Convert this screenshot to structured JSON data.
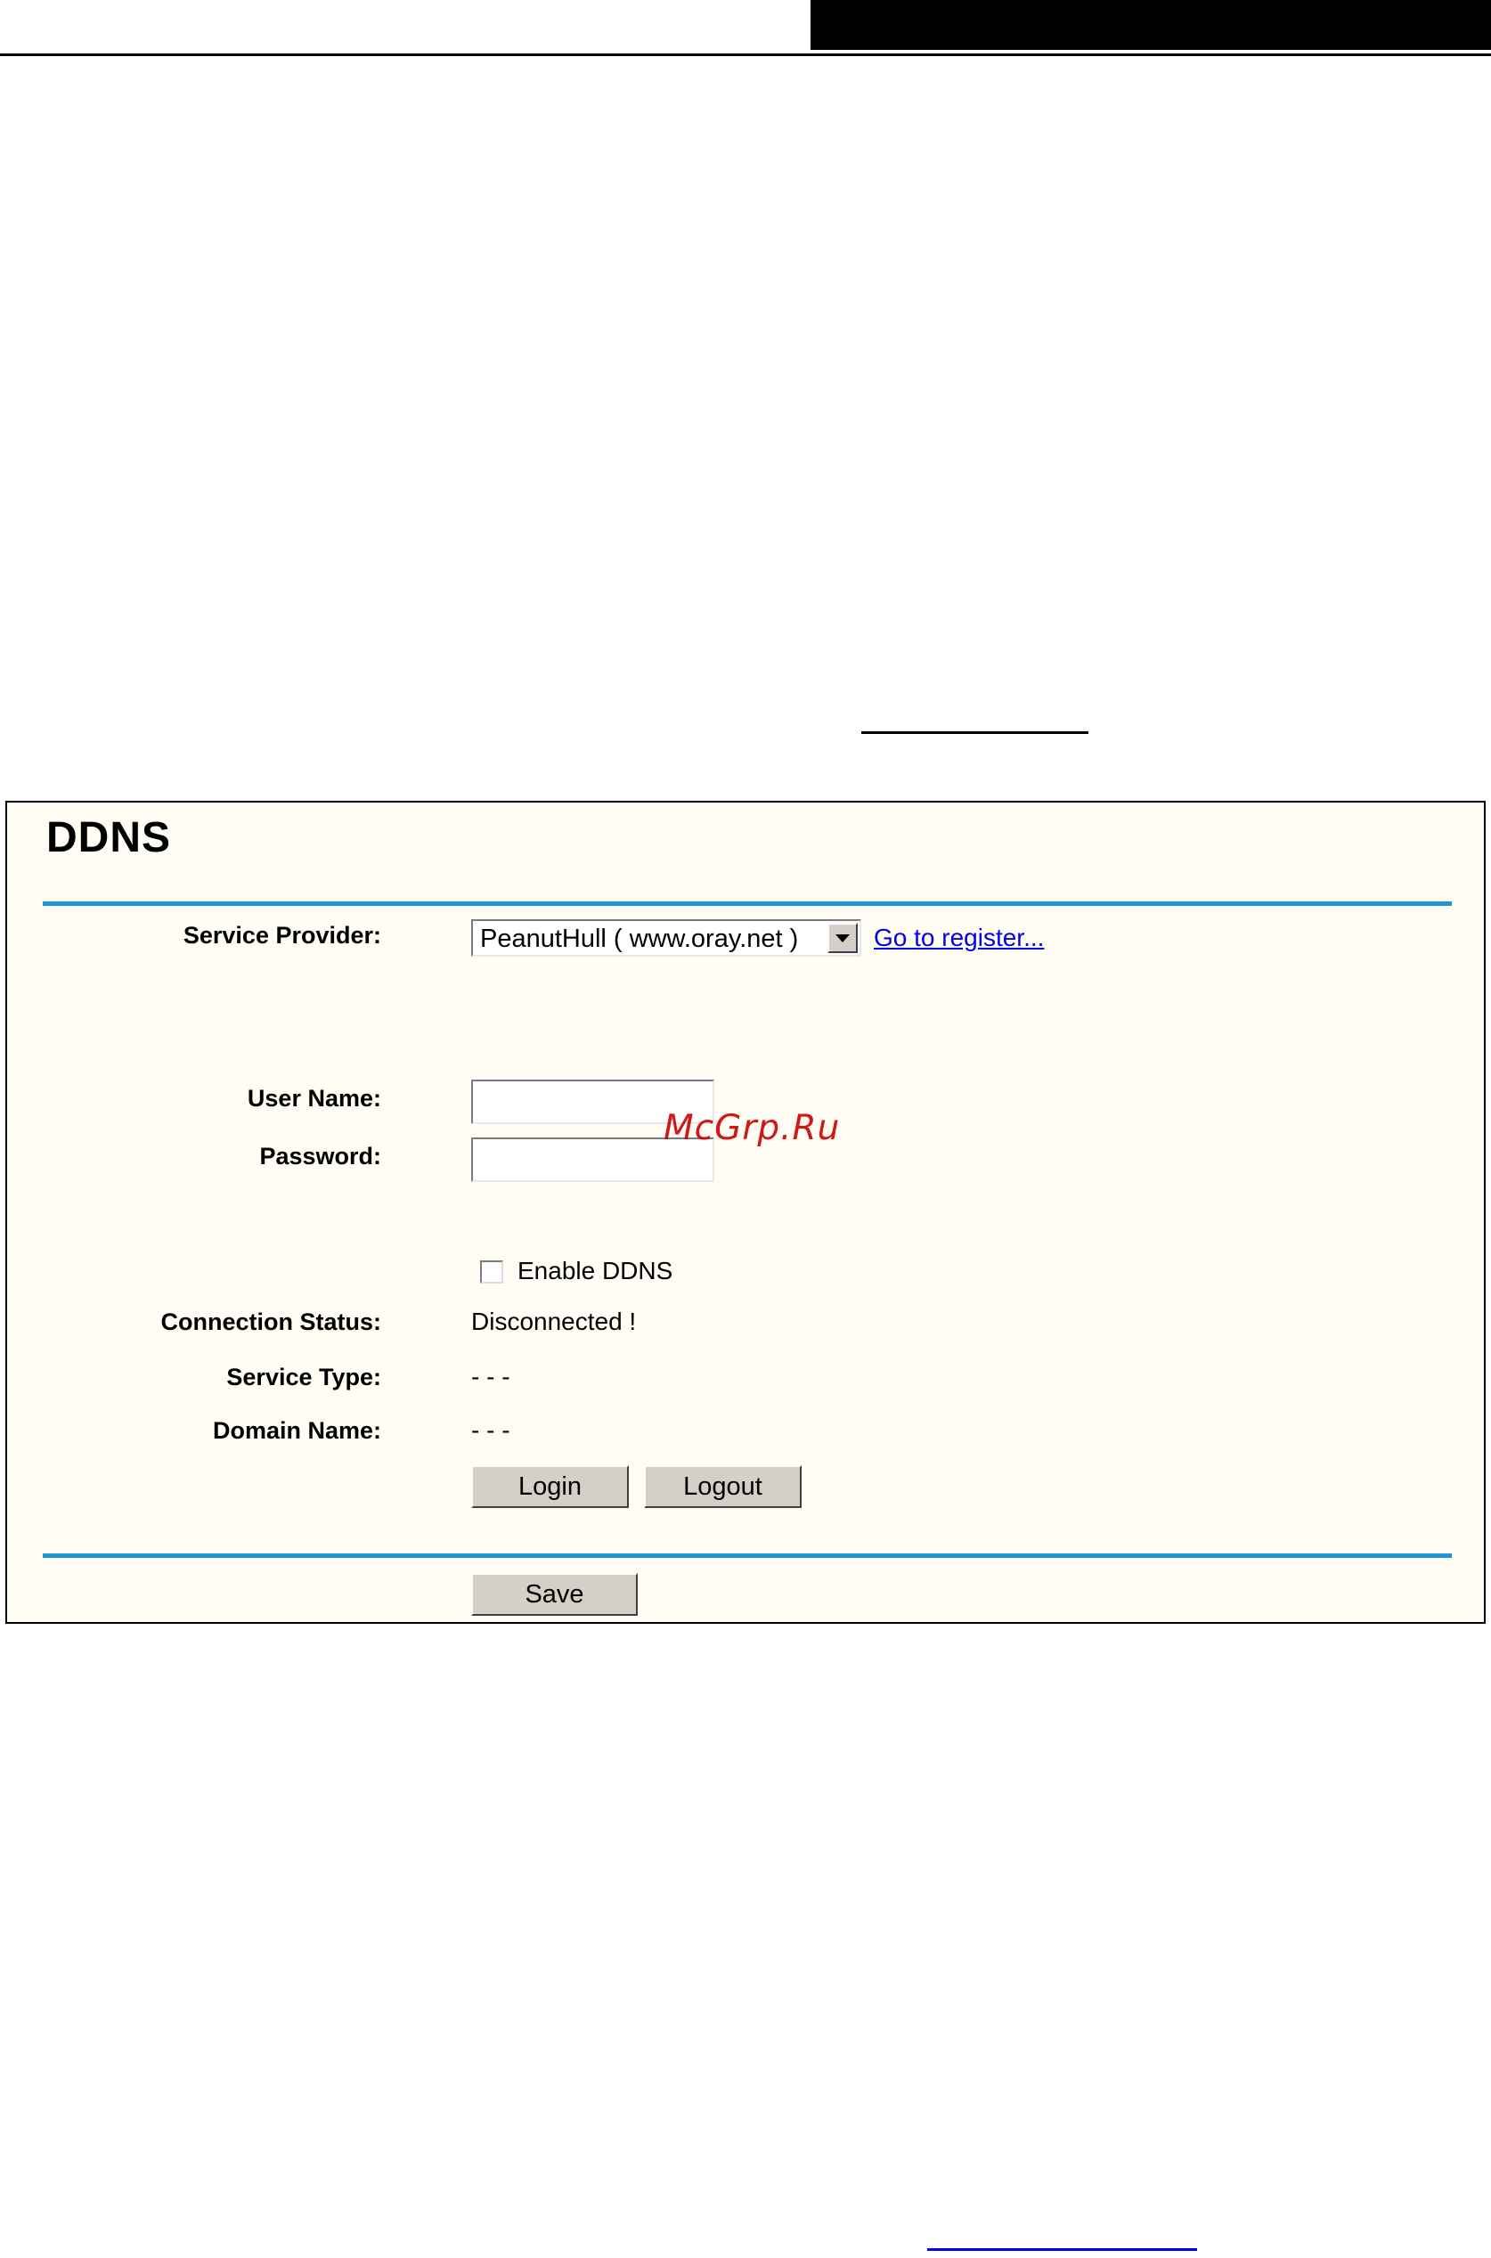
{
  "page": {
    "title": "DDNS",
    "watermark": "McGrp.Ru"
  },
  "form": {
    "service_provider": {
      "label": "Service Provider:",
      "selected": "PeanutHull ( www.oray.net )",
      "register_link": "Go to register..."
    },
    "user_name": {
      "label": "User Name:",
      "value": ""
    },
    "password": {
      "label": "Password:",
      "value": ""
    },
    "enable_ddns": {
      "label": "Enable DDNS",
      "checked": false
    },
    "connection_status": {
      "label": "Connection Status:",
      "value": "Disconnected !"
    },
    "service_type": {
      "label": "Service Type:",
      "value": "- - -"
    },
    "domain_name": {
      "label": "Domain Name:",
      "value": "- - -"
    }
  },
  "buttons": {
    "login": "Login",
    "logout": "Logout",
    "save": "Save"
  },
  "colors": {
    "accent_rule": "#1e95d6",
    "panel_background": "#fffdf4",
    "link": "#0000ee",
    "watermark": "#cc0000"
  }
}
